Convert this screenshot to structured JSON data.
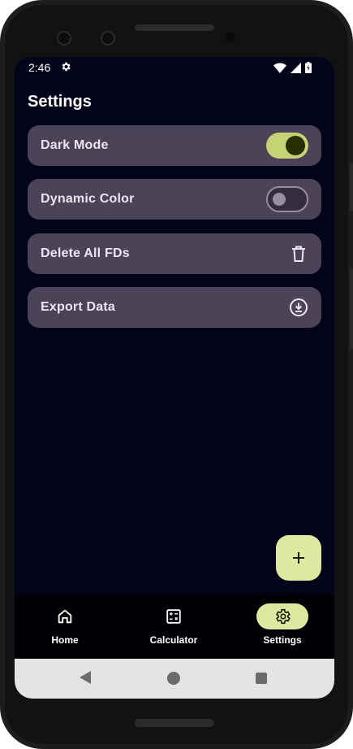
{
  "status_bar": {
    "time": "2:46",
    "settings_icon": "gear-icon",
    "wifi_icon": "wifi-icon",
    "signal_icon": "signal-icon",
    "battery_icon": "battery-icon"
  },
  "page": {
    "title": "Settings"
  },
  "settings": {
    "items": [
      {
        "label": "Dark Mode",
        "control": "toggle",
        "checked": true
      },
      {
        "label": "Dynamic Color",
        "control": "toggle",
        "checked": false
      },
      {
        "label": "Delete All FDs",
        "control": "icon",
        "icon": "trash-icon"
      },
      {
        "label": "Export Data",
        "control": "icon",
        "icon": "download-icon"
      }
    ]
  },
  "fab": {
    "icon": "plus-icon"
  },
  "bottom_nav": {
    "items": [
      {
        "label": "Home",
        "icon": "home-icon",
        "active": false
      },
      {
        "label": "Calculator",
        "icon": "calculator-icon",
        "active": false
      },
      {
        "label": "Settings",
        "icon": "gear-icon",
        "active": true
      }
    ]
  },
  "colors": {
    "background": "#03031a",
    "card": "#4b4358",
    "accent": "#dfe8a0",
    "toggle_on": "#c5d275",
    "toggle_knob_on": "#283000"
  }
}
